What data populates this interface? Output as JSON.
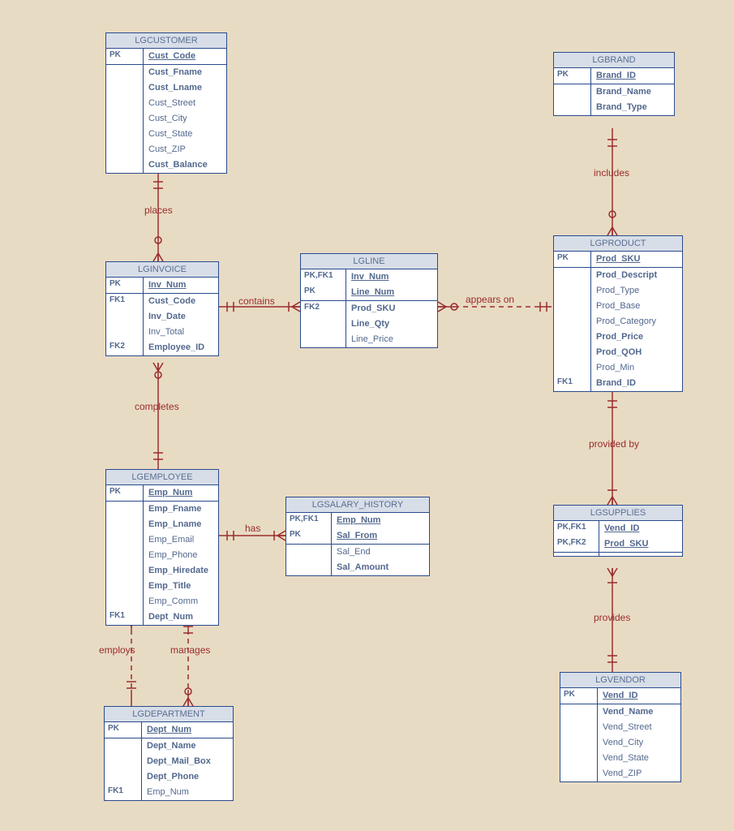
{
  "entities": {
    "lgcustomer": {
      "title": "LGCUSTOMER",
      "sections": [
        [
          {
            "key": "PK",
            "name": "Cust_Code",
            "pk": true
          }
        ],
        [
          {
            "key": "",
            "name": "Cust_Fname",
            "bold": true
          },
          {
            "key": "",
            "name": "Cust_Lname",
            "bold": true
          },
          {
            "key": "",
            "name": "Cust_Street"
          },
          {
            "key": "",
            "name": "Cust_City"
          },
          {
            "key": "",
            "name": "Cust_State"
          },
          {
            "key": "",
            "name": "Cust_ZIP"
          },
          {
            "key": "",
            "name": "Cust_Balance",
            "bold": true
          }
        ]
      ]
    },
    "lginvoice": {
      "title": "LGINVOICE",
      "sections": [
        [
          {
            "key": "PK",
            "name": "Inv_Num",
            "pk": true
          }
        ],
        [
          {
            "key": "FK1",
            "name": "Cust_Code",
            "bold": true
          },
          {
            "key": "",
            "name": "Inv_Date",
            "bold": true
          },
          {
            "key": "",
            "name": "Inv_Total"
          },
          {
            "key": "FK2",
            "name": "Employee_ID",
            "bold": true
          }
        ]
      ]
    },
    "lgline": {
      "title": "LGLINE",
      "sections": [
        [
          {
            "key": "PK,FK1",
            "name": "Inv_Num",
            "pk": true
          },
          {
            "key": "PK",
            "name": "Line_Num",
            "pk": true
          }
        ],
        [
          {
            "key": "FK2",
            "name": "Prod_SKU",
            "bold": true
          },
          {
            "key": "",
            "name": "Line_Qty",
            "bold": true
          },
          {
            "key": "",
            "name": "Line_Price"
          }
        ]
      ]
    },
    "lgemployee": {
      "title": "LGEMPLOYEE",
      "sections": [
        [
          {
            "key": "PK",
            "name": "Emp_Num",
            "pk": true
          }
        ],
        [
          {
            "key": "",
            "name": "Emp_Fname",
            "bold": true
          },
          {
            "key": "",
            "name": "Emp_Lname",
            "bold": true
          },
          {
            "key": "",
            "name": "Emp_Email"
          },
          {
            "key": "",
            "name": "Emp_Phone"
          },
          {
            "key": "",
            "name": "Emp_Hiredate",
            "bold": true
          },
          {
            "key": "",
            "name": "Emp_Title",
            "bold": true
          },
          {
            "key": "",
            "name": "Emp_Comm"
          },
          {
            "key": "FK1",
            "name": "Dept_Num",
            "bold": true
          }
        ]
      ]
    },
    "lgsalary": {
      "title": "LGSALARY_HISTORY",
      "sections": [
        [
          {
            "key": "PK,FK1",
            "name": "Emp_Num",
            "pk": true
          },
          {
            "key": "PK",
            "name": "Sal_From",
            "pk": true
          }
        ],
        [
          {
            "key": "",
            "name": "Sal_End"
          },
          {
            "key": "",
            "name": "Sal_Amount",
            "bold": true
          }
        ]
      ]
    },
    "lgdepartment": {
      "title": "LGDEPARTMENT",
      "sections": [
        [
          {
            "key": "PK",
            "name": "Dept_Num",
            "pk": true
          }
        ],
        [
          {
            "key": "",
            "name": "Dept_Name",
            "bold": true
          },
          {
            "key": "",
            "name": "Dept_Mail_Box",
            "bold": true
          },
          {
            "key": "",
            "name": "Dept_Phone",
            "bold": true
          },
          {
            "key": "FK1",
            "name": "Emp_Num"
          }
        ]
      ]
    },
    "lgbrand": {
      "title": "LGBRAND",
      "sections": [
        [
          {
            "key": "PK",
            "name": "Brand_ID",
            "pk": true
          }
        ],
        [
          {
            "key": "",
            "name": "Brand_Name",
            "bold": true
          },
          {
            "key": "",
            "name": "Brand_Type",
            "bold": true
          }
        ]
      ]
    },
    "lgproduct": {
      "title": "LGPRODUCT",
      "sections": [
        [
          {
            "key": "PK",
            "name": "Prod_SKU",
            "pk": true
          }
        ],
        [
          {
            "key": "",
            "name": "Prod_Descript",
            "bold": true
          },
          {
            "key": "",
            "name": "Prod_Type"
          },
          {
            "key": "",
            "name": "Prod_Base"
          },
          {
            "key": "",
            "name": "Prod_Category"
          },
          {
            "key": "",
            "name": "Prod_Price",
            "bold": true
          },
          {
            "key": "",
            "name": "Prod_QOH",
            "bold": true
          },
          {
            "key": "",
            "name": "Prod_Min"
          },
          {
            "key": "FK1",
            "name": "Brand_ID",
            "bold": true
          }
        ]
      ]
    },
    "lgsupplies": {
      "title": "LGSUPPLIES",
      "sections": [
        [
          {
            "key": "PK,FK1",
            "name": "Vend_ID",
            "pk": true
          },
          {
            "key": "PK,FK2",
            "name": "Prod_SKU",
            "pk": true
          }
        ],
        [
          {
            "key": "",
            "name": " "
          }
        ]
      ]
    },
    "lgvendor": {
      "title": "LGVENDOR",
      "sections": [
        [
          {
            "key": "PK",
            "name": "Vend_ID",
            "pk": true
          }
        ],
        [
          {
            "key": "",
            "name": "Vend_Name",
            "bold": true
          },
          {
            "key": "",
            "name": "Vend_Street"
          },
          {
            "key": "",
            "name": "Vend_City"
          },
          {
            "key": "",
            "name": "Vend_State"
          },
          {
            "key": "",
            "name": "Vend_ZIP"
          }
        ]
      ]
    }
  },
  "relationships": {
    "places": {
      "label": "places"
    },
    "contains": {
      "label": "contains"
    },
    "appears_on": {
      "label": "appears on"
    },
    "completes": {
      "label": "completes"
    },
    "has": {
      "label": "has"
    },
    "employs": {
      "label": "employs"
    },
    "manages": {
      "label": "manages"
    },
    "includes": {
      "label": "includes"
    },
    "provided_by": {
      "label": "provided by"
    },
    "provides": {
      "label": "provides"
    }
  }
}
